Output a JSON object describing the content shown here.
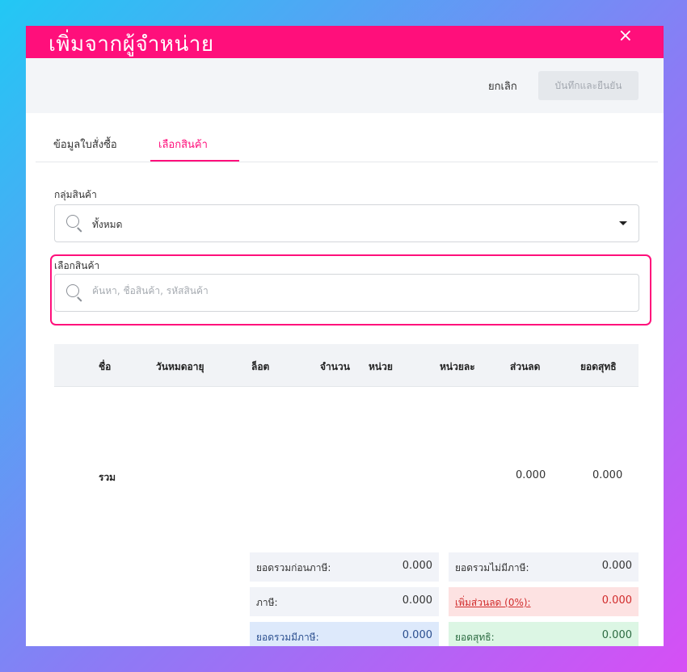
{
  "modal": {
    "title": "เพิ่มจากผู้จำหน่าย",
    "close_icon": "×"
  },
  "toolbar": {
    "cancel_label": "ยกเลิก",
    "confirm_label": "บันทึกและยืนยัน"
  },
  "tabs": [
    {
      "label": "ข้อมูลใบสั่งซื้อ",
      "active": false
    },
    {
      "label": "เลือกสินค้า",
      "active": true
    }
  ],
  "group": {
    "label": "กลุ่มสินค้า",
    "value": "ทั้งหมด"
  },
  "product": {
    "label": "เลือกสินค้า",
    "placeholder": "ค้นหา, ชื่อสินค้า, รหัสสินค้า"
  },
  "table": {
    "columns": [
      "ชื่อ",
      "วันหมดอายุ",
      "ล็อต",
      "จำนวน",
      "หน่วย",
      "หน่วยละ",
      "ส่วนลด",
      "ยอดสุทธิ"
    ],
    "total_label": "รวม",
    "total_discount": "0.000",
    "total_net": "0.000"
  },
  "summary": {
    "subtotal_before_tax_label": "ยอดรวมก่อนภาษี:",
    "subtotal_before_tax_value": "0.000",
    "no_tax_total_label": "ยอดรวมไม่มีภาษี:",
    "no_tax_total_value": "0.000",
    "tax_label": "ภาษี:",
    "tax_value": "0.000",
    "add_discount_label": "เพิ่มส่วนลด (0%):",
    "add_discount_value": "0.000",
    "total_with_tax_label": "ยอดรวมมีภาษี:",
    "total_with_tax_value": "0.000",
    "net_label": "ยอดสุทธิ:",
    "net_value": "0.000"
  },
  "colors": {
    "accent": "#ff0f7b",
    "discount_bg": "#fde2e2",
    "tax_total_bg": "#dde9fb",
    "net_bg": "#dcf6e4"
  }
}
